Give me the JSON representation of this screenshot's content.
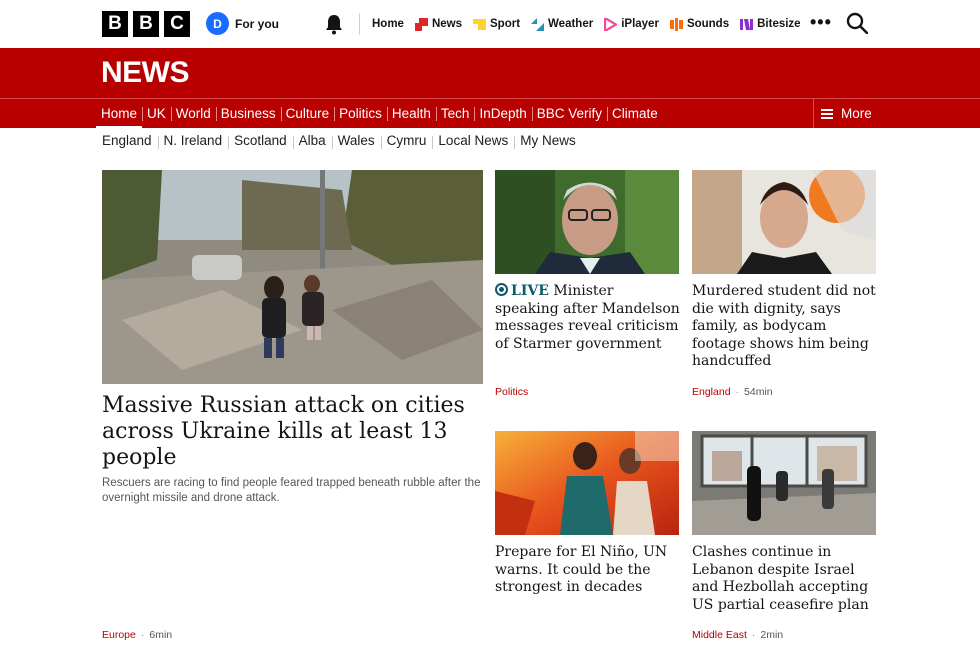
{
  "logo": {
    "letters": [
      "B",
      "B",
      "C"
    ]
  },
  "account": {
    "initial": "D",
    "label": "For you"
  },
  "topnav": [
    {
      "label": "Home",
      "icon": "none"
    },
    {
      "label": "News",
      "icon": "news-icon",
      "color": "#e0262a"
    },
    {
      "label": "Sport",
      "icon": "sport-icon",
      "color": "#ffd230"
    },
    {
      "label": "Weather",
      "icon": "weather-icon",
      "color": "#2a8fb5"
    },
    {
      "label": "iPlayer",
      "icon": "iplayer-icon",
      "color": "#f54997"
    },
    {
      "label": "Sounds",
      "icon": "sounds-icon",
      "color": "#ff6d00"
    },
    {
      "label": "Bitesize",
      "icon": "bitesize-icon",
      "color": "#8b2ed6"
    }
  ],
  "masthead": {
    "title": "NEWS"
  },
  "primary_nav": {
    "items": [
      "Home",
      "UK",
      "World",
      "Business",
      "Culture",
      "Politics",
      "Health",
      "Tech",
      "InDepth",
      "BBC Verify",
      "Climate"
    ],
    "active": "Home",
    "more_label": "More"
  },
  "secondary_nav": [
    "England",
    "N. Ireland",
    "Scotland",
    "Alba",
    "Wales",
    "Cymru",
    "Local News",
    "My News"
  ],
  "lead": {
    "headline": "Massive Russian attack on cities across Ukraine kills at least 13 people",
    "summary": "Rescuers are racing to find people feared trapped beneath rubble after the overnight missile and drone attack.",
    "category": "Europe",
    "time": "6min"
  },
  "stories": [
    {
      "live_label": "LIVE",
      "headline": "Minister speaking after Mandelson messages reveal criticism of Starmer government",
      "category": "Politics",
      "time": ""
    },
    {
      "headline": "Murdered student did not die with dignity, says family, as bodycam footage shows him being handcuffed",
      "category": "England",
      "time": "54min"
    },
    {
      "headline": "Prepare for El Niño, UN warns. It could be the strongest in decades",
      "category": "",
      "time": ""
    },
    {
      "headline": "Clashes continue in Lebanon despite Israel and Hezbollah accepting US partial ceasefire plan",
      "category": "Middle East",
      "time": "2min"
    }
  ],
  "colors": {
    "brand_red": "#b80000",
    "live_teal": "#0e5a6b",
    "text": "#141414",
    "muted": "#545658"
  }
}
